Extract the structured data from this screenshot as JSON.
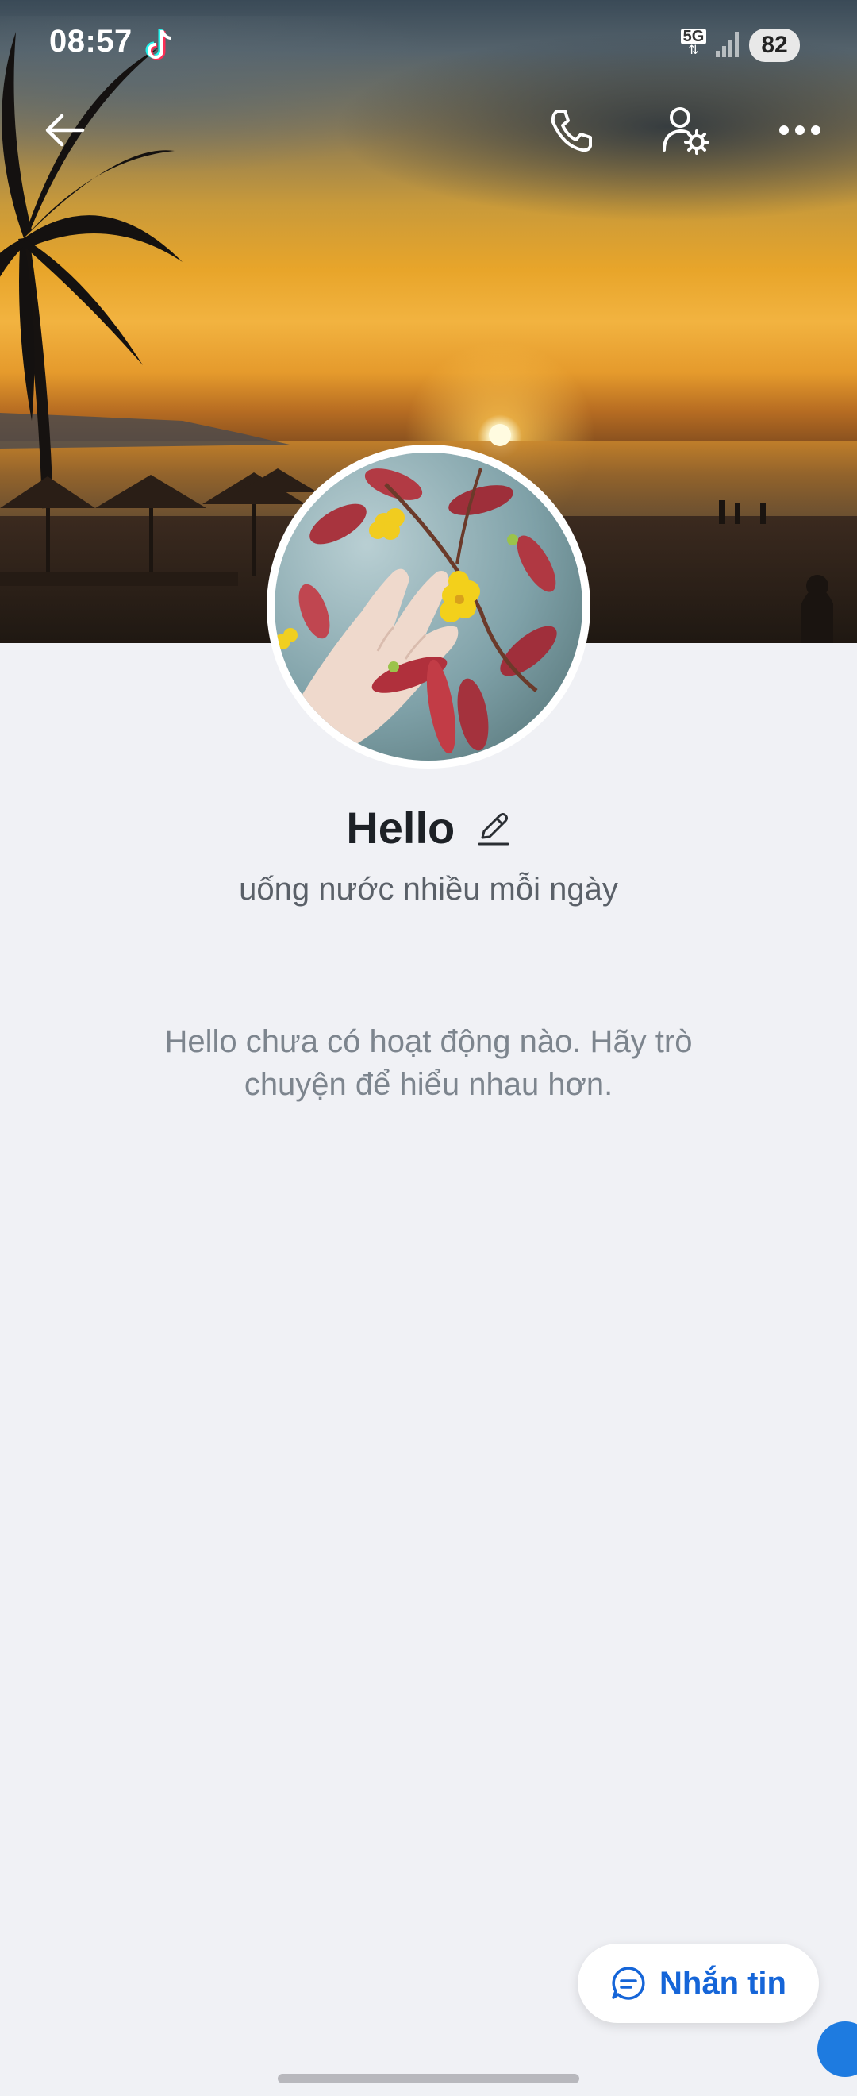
{
  "status_bar": {
    "time": "08:57",
    "network": "5G",
    "battery": "82"
  },
  "nav": {
    "back_icon": "back-arrow-icon",
    "call_icon": "phone-icon",
    "settings_icon": "user-settings-icon",
    "more_icon": "more-dots-icon"
  },
  "profile": {
    "name": "Hello",
    "bio": "uống nước nhiều mỗi ngày",
    "empty_message": "Hello chưa có hoạt động nào. Hãy trò chuyện để hiểu nhau hơn."
  },
  "actions": {
    "message_label": "Nhắn tin"
  },
  "colors": {
    "accent": "#1565d8",
    "background": "#f0f1f5"
  }
}
